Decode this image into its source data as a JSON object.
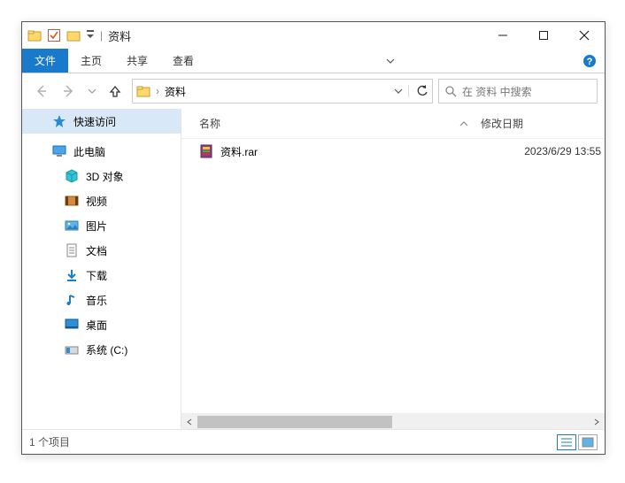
{
  "title_sep": "|",
  "title": "资料",
  "ribbon": {
    "file": "文件",
    "home": "主页",
    "share": "共享",
    "view": "查看"
  },
  "address": {
    "crumb": "资料",
    "crumb_sep": "›"
  },
  "search": {
    "placeholder": "在 资料 中搜索"
  },
  "sidebar": {
    "quick_access": "快速访问",
    "this_pc": "此电脑",
    "objects_3d": "3D 对象",
    "videos": "视频",
    "pictures": "图片",
    "documents": "文档",
    "downloads": "下载",
    "music": "音乐",
    "desktop": "桌面",
    "system_c": "系统 (C:)"
  },
  "columns": {
    "name": "名称",
    "date": "修改日期"
  },
  "files": [
    {
      "name": "资料.rar",
      "date": "2023/6/29 13:55"
    }
  ],
  "status": {
    "item_count": "1 个项目"
  }
}
